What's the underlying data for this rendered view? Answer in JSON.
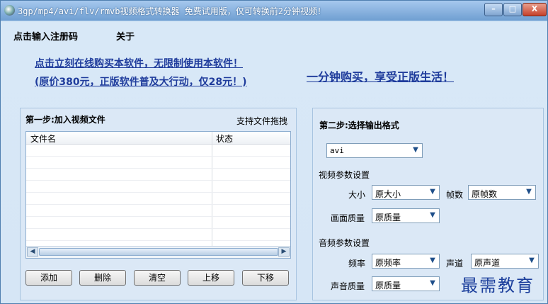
{
  "window": {
    "title": "3gp/mp4/avi/flv/rmvb视频格式转换器   免费试用版，仅可转换前2分钟视频！",
    "controls": {
      "minimize": "–",
      "maximize": "□",
      "close": "X"
    }
  },
  "menu": {
    "register": "点击输入注册码",
    "about": "关于"
  },
  "promo": {
    "line1": "点击立刻在线购买本软件，无限制使用本软件！",
    "line2": "(原价380元，正版软件普及大行动，仅28元！)",
    "right": "一分钟购买，享受正版生活！"
  },
  "step1": {
    "title": "第一步:加入视频文件",
    "drag_hint": "支持文件拖拽",
    "columns": [
      "文件名",
      "状态"
    ],
    "buttons": {
      "add": "添加",
      "delete": "删除",
      "clear": "清空",
      "up": "上移",
      "down": "下移"
    }
  },
  "step2": {
    "title": "第二步:选择输出格式",
    "format": "avi",
    "video_section": "视频参数设置",
    "size_label": "大小",
    "size_value": "原大小",
    "fps_label": "帧数",
    "fps_value": "原帧数",
    "quality_label": "画面质量",
    "quality_value": "原质量",
    "audio_section": "音频参数设置",
    "freq_label": "频率",
    "freq_value": "原频率",
    "channel_label": "声道",
    "channel_value": "原声道",
    "audio_quality_label": "声音质量",
    "audio_quality_value": "原质量"
  },
  "watermark": "最需教育",
  "icons": [
    "app-icon",
    "chevron-down-icon",
    "scroll-left-icon",
    "scroll-right-icon"
  ],
  "colors": {
    "link": "#1f3c9c",
    "watermark": "#1c3f9c",
    "title_bar": "#76a6d8"
  }
}
